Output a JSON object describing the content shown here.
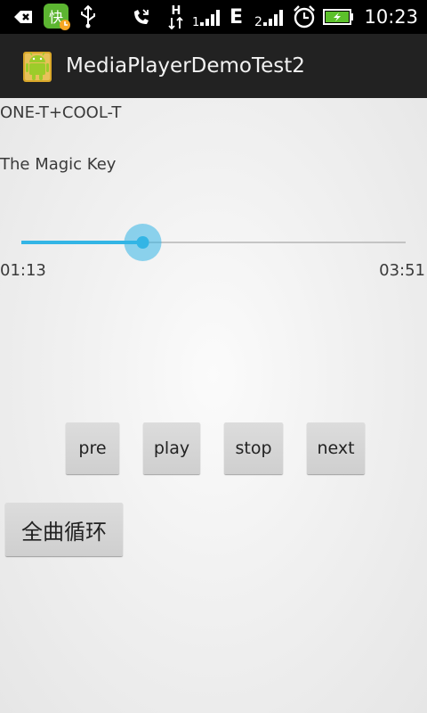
{
  "status_bar": {
    "time": "10:23",
    "icons": [
      "back-icon",
      "app-notification-icon",
      "usb-icon",
      "missed-call-icon",
      "data-hspa-icon",
      "signal-icon",
      "edge-icon",
      "signal-2-icon",
      "alarm-icon",
      "battery-charging-icon"
    ],
    "network_label": "E",
    "hspa_label": "H"
  },
  "action_bar": {
    "title": "MediaPlayerDemoTest2"
  },
  "player": {
    "artist": "ONE-T+COOL-T",
    "track": "The Magic Key",
    "current_time": "01:13",
    "total_time": "03:51",
    "progress_fraction": 0.316
  },
  "controls": {
    "pre": "pre",
    "play": "play",
    "stop": "stop",
    "next": "next",
    "loop_mode": "全曲循环"
  },
  "colors": {
    "accent": "#33b5e5",
    "action_bar_bg": "#222222",
    "status_bar_bg": "#000000"
  }
}
